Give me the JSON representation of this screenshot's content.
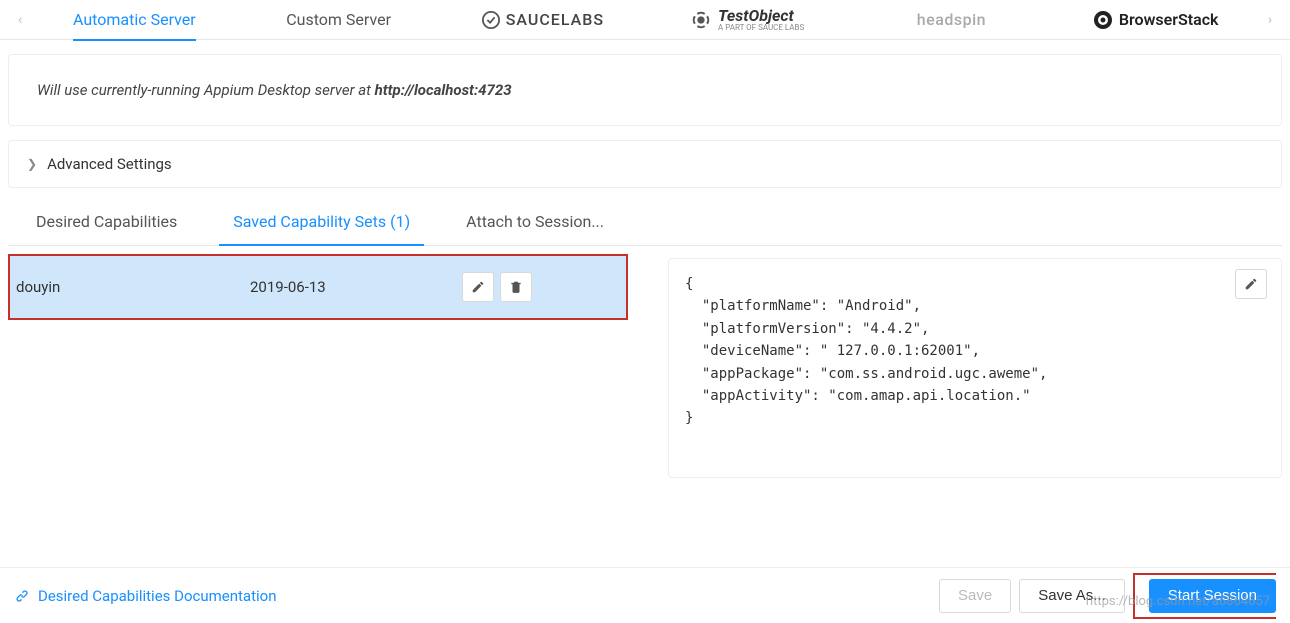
{
  "serverTabs": {
    "automatic": "Automatic Server",
    "custom": "Custom Server",
    "saucelabs": "SAUCELABS",
    "testobject_title": "TestObject",
    "testobject_sub": "A PART OF SAUCE LABS",
    "headspin": "headspin",
    "browserstack": "BrowserStack"
  },
  "info": {
    "prefix": "Will use currently-running Appium Desktop server at ",
    "url": "http://localhost:4723"
  },
  "advanced": {
    "label": "Advanced Settings"
  },
  "subtabs": {
    "desired": "Desired Capabilities",
    "saved": "Saved Capability Sets (1)",
    "attach": "Attach to Session..."
  },
  "savedSets": [
    {
      "name": "douyin",
      "date": "2019-06-13"
    }
  ],
  "capabilitiesJson": "{\n  \"platformName\": \"Android\",\n  \"platformVersion\": \"4.4.2\",\n  \"deviceName\": \" 127.0.0.1:62001\",\n  \"appPackage\": \"com.ss.android.ugc.aweme\",\n  \"appActivity\": \"com.amap.api.location.\"\n}",
  "footer": {
    "docs": "Desired Capabilities Documentation",
    "save": "Save",
    "saveAs": "Save As...",
    "start": "Start Session"
  },
  "watermark": "https://blog.csdn.net/a6864657"
}
